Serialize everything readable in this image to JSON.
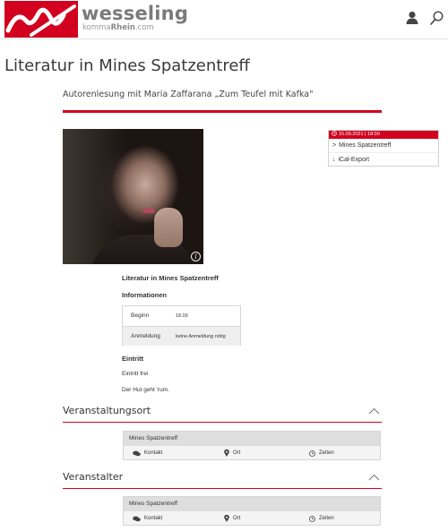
{
  "brand": {
    "name": "wesseling",
    "sub_prefix": "komma",
    "sub_bold": "Rhein",
    "sub_suffix": ".com",
    "accent": "#d2001e"
  },
  "header": {
    "icons": [
      "user-icon",
      "search-icon"
    ]
  },
  "page": {
    "title": "Literatur in Mines Spatzentreff",
    "subtitle": "Autorenlesung mit Maria Zaffarana „Zum Teufel mit Kafka\""
  },
  "datebox": {
    "header": "15.09.2021 | 18:00",
    "items": [
      {
        "label": "Mines Spatzentreff",
        "glyph": ">"
      },
      {
        "label": "iCal-Export",
        "glyph": "↓"
      }
    ]
  },
  "details": {
    "title": "Literatur in Mines Spatzentreff",
    "info_heading": "Informationen",
    "rows": [
      {
        "key": "Beginn",
        "value": "18.00"
      },
      {
        "key": "Anmeldung",
        "value": "keine Anmeldung nötig"
      }
    ],
    "eintritt_heading": "Eintritt",
    "eintritt_lines": [
      "Eintritt frei",
      "Der Hut geht 'rum."
    ]
  },
  "sections": [
    {
      "title": "Veranstaltungsort",
      "card_title": "Mines Spatzentreff",
      "actions": [
        "Kontakt",
        "Ort",
        "Zeiten"
      ]
    },
    {
      "title": "Veranstalter",
      "card_title": "Mines Spatzentreff",
      "actions": [
        "Kontakt",
        "Ort",
        "Zeiten"
      ]
    }
  ]
}
